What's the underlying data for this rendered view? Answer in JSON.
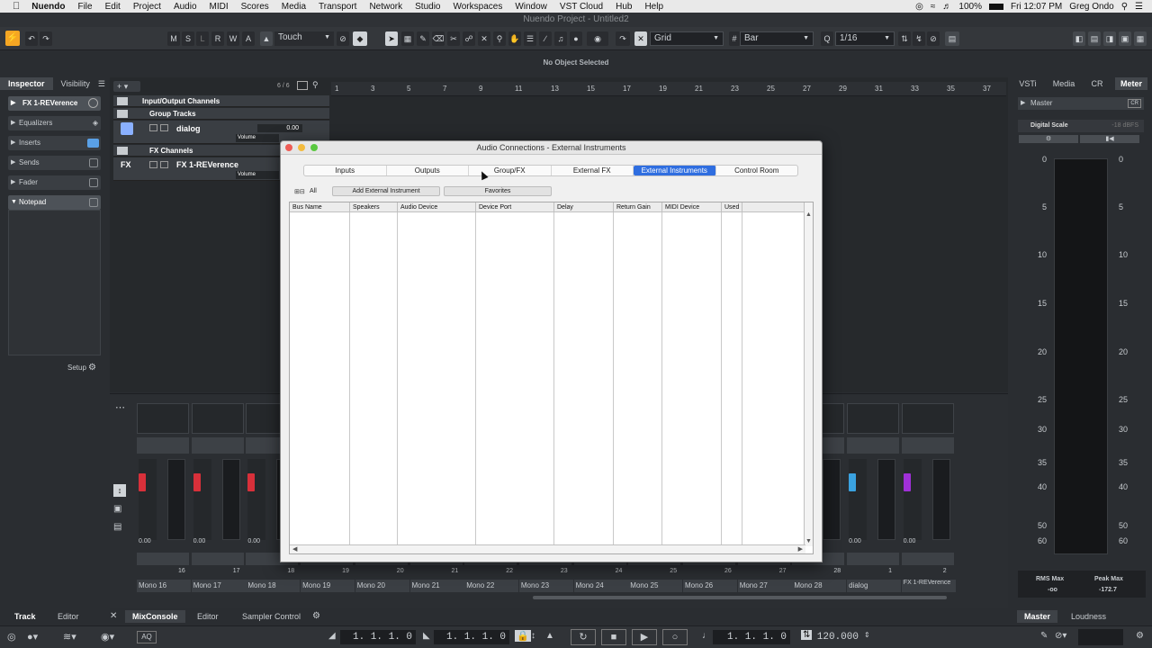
{
  "menubar": {
    "app": "Nuendo",
    "items": [
      "File",
      "Edit",
      "Project",
      "Audio",
      "MIDI",
      "Scores",
      "Media",
      "Transport",
      "Network",
      "Studio",
      "Workspaces",
      "Window",
      "VST Cloud",
      "Hub",
      "Help"
    ],
    "battery": "100%",
    "clock": "Fri 12:07 PM",
    "user": "Greg Ondo"
  },
  "window": {
    "title": "Nuendo Project - Untitled2"
  },
  "toolbar": {
    "mode_buttons": [
      "M",
      "S",
      "L",
      "R",
      "W",
      "A"
    ],
    "automation_mode": "Touch",
    "snap_type": "Grid",
    "grid_type": "Bar",
    "quantize": "1/16"
  },
  "infoline": {
    "text": "No Object Selected"
  },
  "inspector": {
    "tabs": [
      "Inspector",
      "Visibility"
    ],
    "track_name": "FX 1-REVerence",
    "sections": [
      "Equalizers",
      "Inserts",
      "Sends",
      "Fader",
      "Notepad"
    ],
    "setup_label": "Setup"
  },
  "project": {
    "track_count": "6 / 6",
    "tracks": {
      "io": "Input/Output Channels",
      "group": "Group Tracks",
      "dialog_name": "dialog",
      "dialog_value": "0.00",
      "volume_label": "Volume",
      "fx": "FX Channels",
      "fx_name": "FX 1-REVerence",
      "fx_badge": "FX"
    },
    "ruler": [
      "1",
      "3",
      "5",
      "7",
      "9",
      "11",
      "13",
      "15",
      "17",
      "19",
      "21",
      "23",
      "25",
      "27",
      "29",
      "31",
      "33",
      "35",
      "37"
    ]
  },
  "dialog": {
    "title": "Audio Connections - External Instruments",
    "tabs": [
      "Inputs",
      "Outputs",
      "Group/FX",
      "External FX",
      "External Instruments",
      "Control Room"
    ],
    "active_tab": "External Instruments",
    "all_label": "All",
    "add_button": "Add External Instrument",
    "favorites_button": "Favorites",
    "columns": [
      "Bus Name",
      "Speakers",
      "Audio Device",
      "Device Port",
      "Delay",
      "Return Gain",
      "MIDI Device",
      "Used"
    ]
  },
  "rightzone": {
    "tabs": [
      "VSTi",
      "Media",
      "CR",
      "Meter"
    ],
    "active_tab": "Meter",
    "section": "Master",
    "cr_badge": "CR",
    "scale_label": "Digital Scale",
    "scale_value": "-18 dBFS",
    "scale_ticks": [
      "0",
      "5",
      "10",
      "15",
      "20",
      "25",
      "30",
      "35",
      "40",
      "50",
      "60"
    ],
    "rms_label": "RMS Max",
    "rms_value": "-oo",
    "peak_label": "Peak Max",
    "peak_value": "-172.7",
    "bottom_tabs": [
      "Master",
      "Loudness"
    ]
  },
  "mixer": {
    "channels": [
      {
        "num": "16",
        "name": "Mono 16"
      },
      {
        "num": "17",
        "name": "Mono 17"
      },
      {
        "num": "18",
        "name": "Mono 18"
      },
      {
        "num": "19",
        "name": "Mono 19"
      },
      {
        "num": "20",
        "name": "Mono 20"
      },
      {
        "num": "21",
        "name": "Mono 21"
      },
      {
        "num": "22",
        "name": "Mono 22"
      },
      {
        "num": "23",
        "name": "Mono 23"
      },
      {
        "num": "24",
        "name": "Mono 24"
      },
      {
        "num": "25",
        "name": "Mono 25"
      },
      {
        "num": "26",
        "name": "Mono 26"
      },
      {
        "num": "27",
        "name": "Mono 27"
      },
      {
        "num": "28",
        "name": "Mono 28"
      },
      {
        "num": "1",
        "name": "dialog"
      },
      {
        "num": "2",
        "name": "FX 1-REVerence"
      }
    ],
    "fader_value": "0.00",
    "peak_value": "-oo",
    "pan_label": "C",
    "scale": [
      "12",
      "6",
      "3",
      "0",
      "3",
      "6",
      "12",
      "18",
      "24",
      "30",
      "36",
      "48",
      "60"
    ]
  },
  "bottom": {
    "left_tabs": [
      "Track",
      "Editor"
    ],
    "center_tabs": [
      "MixConsole",
      "Editor",
      "Sampler Control"
    ],
    "active_center": "MixConsole"
  },
  "transport": {
    "left_locator": "1. 1. 1.    0",
    "right_locator": "1. 1. 1.    0",
    "position": "1. 1. 1.    0",
    "tempo": "120.000",
    "aq": "AQ"
  },
  "colors": {
    "accent_blue": "#2f6ee0",
    "logo_orange": "#f5a623",
    "fader_red": "#d8303a",
    "fader_blue": "#3aa2e0",
    "fader_purple": "#a030d8"
  }
}
